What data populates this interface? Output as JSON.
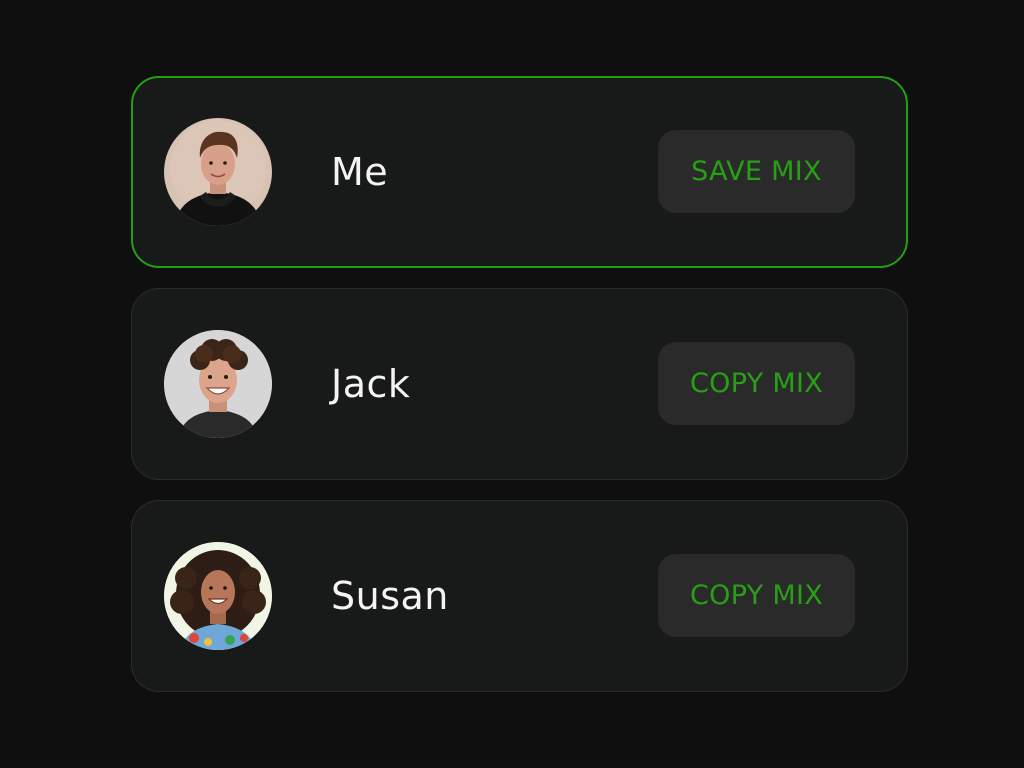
{
  "users": [
    {
      "name": "Me",
      "action_label": "SAVE MIX",
      "avatar_icon": "avatar-man-black-hoodie",
      "selected": true
    },
    {
      "name": "Jack",
      "action_label": "COPY MIX",
      "avatar_icon": "avatar-man-curly-hair",
      "selected": false
    },
    {
      "name": "Susan",
      "action_label": "COPY MIX",
      "avatar_icon": "avatar-woman-curly-hair",
      "selected": false
    }
  ],
  "colors": {
    "background": "#0f0f0f",
    "card": "#181919",
    "card_border": "#2b2c2c",
    "accent": "#22a012",
    "button_bg": "#2a2a2a",
    "text": "#f4f4f4"
  }
}
